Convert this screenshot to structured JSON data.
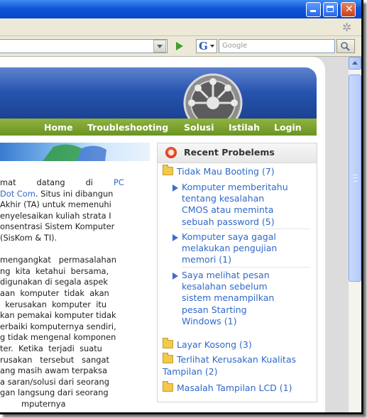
{
  "browser": {
    "search_placeholder": "Google",
    "search_engine_letter": "G"
  },
  "nav": {
    "items": [
      "Home",
      "Troubleshooting",
      "Solusi",
      "Istilah",
      "Login"
    ]
  },
  "article": {
    "para1": [
      {
        "text": "mat        datang        di        ",
        "link": "PC"
      },
      {
        "text": "",
        "link": "Dot Com",
        "after": ". Situs ini dibangun"
      },
      {
        "text": "Akhir (TA) untuk memenuhi"
      },
      {
        "text": "enyelesaikan kuliah strata I"
      },
      {
        "text": "onsentrasi Sistem Komputer"
      },
      {
        "text": "(SisKom & TI)."
      }
    ],
    "para2": [
      "mengangkat   permasalahan",
      "ng  kita  ketahui  bersama,",
      "digunakan di segala aspek",
      "aan  komputer  tidak  akan",
      "  kerusakan  komputer  itu",
      "kan pemakai komputer tidak",
      "erbaiki komputernya sendiri,",
      "g tidak mengenal komponen",
      "ter.  Ketika  terjadi  suatu",
      "rusakan   tersebut   sangat",
      "ang masih awam terpaksa",
      "a saran/solusi dari seorang",
      "gan langsung dari seorang",
      "mputernya"
    ]
  },
  "sidebar": {
    "title": "Recent Probelems",
    "categories": [
      {
        "label": "Tidak Mau Booting (7)"
      },
      {
        "label": "Layar Kosong (3)"
      },
      {
        "label_lines": [
          "Terlihat Kerusakan Kualitas",
          "Tampilan (2)"
        ]
      },
      {
        "label": "Masalah Tampilan LCD (1)"
      }
    ],
    "subitems": [
      {
        "lines": [
          "Komputer memberitahu",
          "tentang kesalahan",
          "CMOS atau meminta",
          "sebuah password (5)"
        ]
      },
      {
        "lines": [
          "Komputer saya gagal",
          "melakukan pengujian",
          "memori (1)"
        ]
      },
      {
        "lines": [
          "Saya melihat pesan",
          "kesalahan sebelum",
          "sistem menampilkan",
          "pesan Starting",
          "Windows (1)"
        ]
      }
    ]
  },
  "colors": {
    "titlebar": "#0a47c9",
    "banner": "#2450a8",
    "navbar": "#7aa22f",
    "link": "#2f69c9"
  }
}
